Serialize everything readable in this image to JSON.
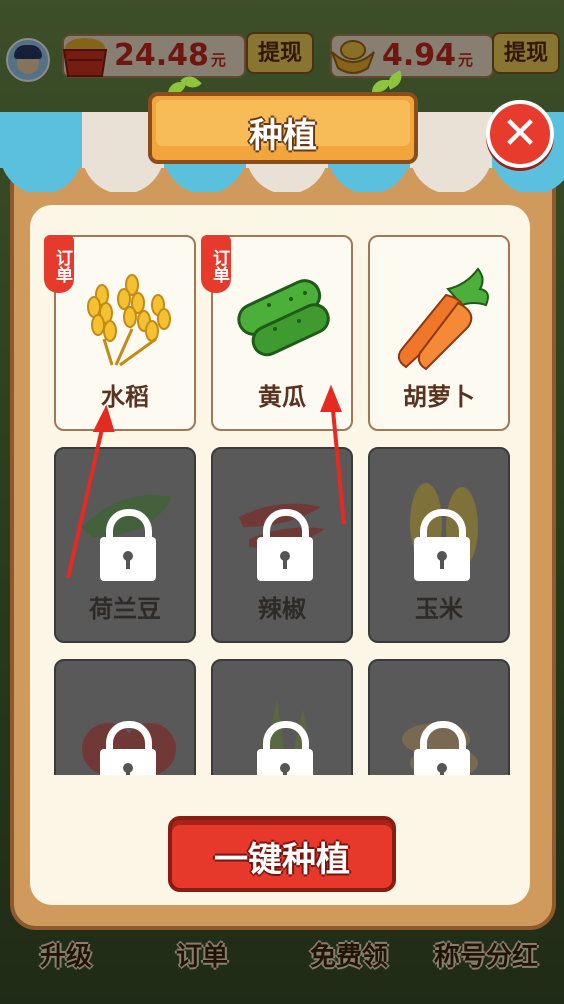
{
  "top_bar": {
    "balance_1": {
      "amount": "24.48",
      "unit": "元"
    },
    "withdraw_1": "提现",
    "balance_2": {
      "amount": "4.94",
      "unit": "元"
    },
    "withdraw_2": "提现"
  },
  "modal": {
    "title": "种植",
    "close_icon": "close-icon",
    "plant_all_button": "一键种植",
    "crops": [
      {
        "name": "水稻",
        "locked": false,
        "badge": "订单",
        "icon": "rice-icon"
      },
      {
        "name": "黄瓜",
        "locked": false,
        "badge": "订单",
        "icon": "cucumber-icon"
      },
      {
        "name": "胡萝卜",
        "locked": false,
        "badge": "",
        "icon": "carrot-icon"
      },
      {
        "name": "荷兰豆",
        "locked": true,
        "badge": "",
        "icon": "pea-icon"
      },
      {
        "name": "辣椒",
        "locked": true,
        "badge": "",
        "icon": "chili-icon"
      },
      {
        "name": "玉米",
        "locked": true,
        "badge": "",
        "icon": "corn-icon"
      },
      {
        "name": "",
        "locked": true,
        "badge": "",
        "icon": "tomato-icon"
      },
      {
        "name": "",
        "locked": true,
        "badge": "",
        "icon": "bamboo-shoot-icon"
      },
      {
        "name": "",
        "locked": true,
        "badge": "",
        "icon": "peanut-icon"
      }
    ]
  },
  "bottom_bar": {
    "items": [
      "升级",
      "订单",
      "免费领",
      "称号分红"
    ]
  },
  "colors": {
    "accent_red": "#e6392b",
    "panel": "#fbf6e6",
    "wood": "#d19a5d",
    "locked": "#595959"
  }
}
